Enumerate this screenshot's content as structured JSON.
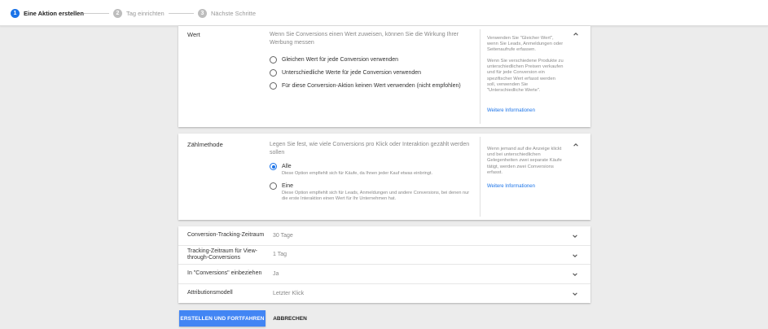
{
  "stepper": {
    "steps": [
      {
        "number": "1",
        "label": "Eine Aktion erstellen",
        "state": "active"
      },
      {
        "number": "2",
        "label": "Tag einrichten",
        "state": "inactive"
      },
      {
        "number": "3",
        "label": "Nächste Schritte",
        "state": "inactive"
      }
    ]
  },
  "wert": {
    "title": "Wert",
    "description": "Wenn Sie Conversions einen Wert zuweisen, können Sie die Wirkung Ihrer Werbung messen",
    "options": [
      {
        "label": "Gleichen Wert für jede Conversion verwenden",
        "checked": false
      },
      {
        "label": "Unterschiedliche Werte für jede Conversion verwenden",
        "checked": false
      },
      {
        "label": "Für diese Conversion-Aktion keinen Wert verwenden (nicht empfohlen)",
        "checked": false
      }
    ],
    "help_p1": "Verwenden Sie \"Gleicher Wert\", wenn Sie Leads, Anmeldungen oder Seitenaufrufe erfassen.",
    "help_p2": "Wenn Sie verschiedene Produkte zu unterschiedlichen Preisen verkaufen und für jede Conversion ein spezifischer Wert erfasst werden soll, verwenden Sie \"Unterschiedliche Werte\".",
    "help_link": "Weitere Informationen"
  },
  "zaehlmethode": {
    "title": "Zählmethode",
    "description": "Legen Sie fest, wie viele Conversions pro Klick oder Interaktion gezählt werden sollen",
    "options": [
      {
        "label": "Alle",
        "sub": "Diese Option empfiehlt sich für Käufe, da Ihnen jeder Kauf etwas einbringt.",
        "checked": true
      },
      {
        "label": "Eine",
        "sub": "Diese Option empfiehlt sich für Leads, Anmeldungen und andere Conversions, bei denen nur die erste Interaktion einen Wert für Ihr Unternehmen hat.",
        "checked": false
      }
    ],
    "help": "Wenn jemand auf die Anzeige klickt und bei unterschiedlichen Gelegenheiten zwei separate Käufe tätigt, werden zwei Conversions erfasst.",
    "help_link": "Weitere Informationen"
  },
  "settings": [
    {
      "label": "Conversion-Tracking-Zeitraum",
      "value": "30 Tage"
    },
    {
      "label": "Tracking-Zeitraum für View-through-Conversions",
      "value": "1 Tag"
    },
    {
      "label": "In \"Conversions\" einbeziehen",
      "value": "Ja"
    },
    {
      "label": "Attributionsmodell",
      "value": "Letzter Klick"
    }
  ],
  "actions": {
    "primary": "ERSTELLEN UND FORTFAHREN",
    "cancel": "ABBRECHEN"
  },
  "colors": {
    "accent": "#1a73e8",
    "primary_button": "#4285f4",
    "background": "#ececec"
  }
}
